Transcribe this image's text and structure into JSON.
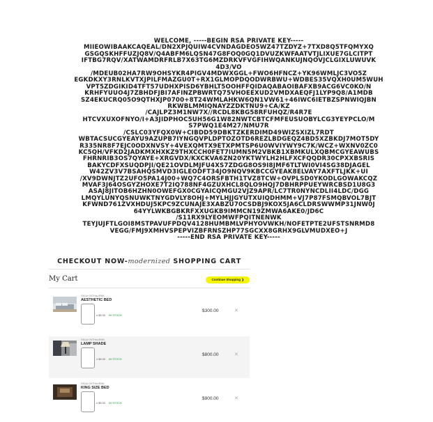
{
  "rsa_key": {
    "lines": [
      "WELCOME, -----BEGIN RSA PRIVATE KEY-----",
      "MIIEOWIBAAKCAQEAL/DN2XPJQUIW4CVNDAGDEO5WZ47TZDYZ+7TXD8Q5TFQMYXQ",
      "GSGQSKHFFUZJQ8V/Q4ABFM6LQSN47G8FOQ0GQ1DVUZKWFAATVTJLIXUE7GLCITPT",
      "IFTBG7RQV/XATWAMDRFRLB7X63TG6MZDRKVFVGFIHWQANKUJNQOVJCLGIXLUWUVK",
      "4D3/VO",
      "/MDEUB02HA7RW9OHSYKR4PIGV4MDWXGGL+FWO6HFNCZ+YK96WMLJC3VO5Z",
      "EGKDKXY3RNLKVTXJPILFMAZGU0T+RX1GLMOPDQODWRBWU+WDBES35VQXH0UM5WUH",
      "VPT5ZDGIKID4TFT57UDHXPISD6YBHLT5OOHFFQIDAQABAOIBAFXB9ACG6VC0KO/N",
      "KRHFYUUO4J7ZBHDFJBI7AFINZPBWRTQ75VHOEEXUD2VMDXAEQFJ1LYP9Q8/A1MDB",
      "SZ4EKUCRQ05O9QTHXJP0700+8T24WMLAHKW6QN1VW61+46IWC6IETBZSPNWIQJBN",
      "RKWBLMMIQNAYZZDKTNU9+CA/KZ",
      "/CAJLPZ3M1NW7X//RCDL8KBG58RFUHQZ/R4R7E",
      "HTCVXUXOFNYO/I+A3JIDPHOC5UH56G1W82NWTCBTCFMFEUSUOBYLCG3YEYPCLO/M",
      "S7PWQ1E4M27/NMU7R",
      "/CSLC03YFQX0W+CIBDD59DBKTZKERDIMD49WIZSXIZL7RDT",
      "WBTACSUCGYEAYU9AZUPB7IYNGQVPLDPTOZOTD6REZLBDGEQZ4BD5XZBKDJ7MOT5DY",
      "R335NR8F7EJC0ODXNVSY+4VEXQMTX9ETXPMTSP6U0WVIYWY9C7K/WCZ+WXNV0ZC0",
      "KC5QH/VFKD2JADKMXHXKZ9THXCCH0FET7IUMN5M2VBKB1XBMKULXQBMCGYEAWUBS",
      "FHRNRIB3OS7QYAYE+XRGVDX/KXCKVA6ZN20YKTWYLH2HLFXCFQQDR30CPXXBSRIS",
      "BAKYCDFXSUQDPJI/QE21OVDLMJFU4XS7ZDGG8OS9I8JMF6TLTWI0VI4SG38DJAGEL",
      "W42ZV3V7BSAHQSMVD3IGLEODFT34JO9NQV9KBCCGYEAK8ELVAY7AXFTLJKK+UI",
      "/XV9DWNJTZ2UFO5PA14J00+WQ7C4ORSFBTH1TVZ8TCW+OVPLSD0YKODLGOWAKCQZ",
      "MVAF3J64OSGYZHOXE7T2IQ788NF4GZUXHCL8QLO9HQJ7DBHRPPUEYWRCBSD1U8G3",
      "ASAJ8JITOB6HZHN0OWEFGX0CGYAICQMGU2VJZ9APR/LC7TR0NYNCDLII4LDC/DGG",
      "LMQYLUNYQSNUWKTNYGDVLY8OHJ+MYLHJJGYUTXUIQDHMM+VJ7P87FSMQBVOL7BJT",
      "KFWND761ZVXHDUJ5KPC9ZCUNAJE3XABZU70CSDBJ9KOX5JA6CLDRSWWMP31JNW0J",
      "64YYLWKBGBKRFXXUGKB9IMMCN19ZMWA6AKE0/JD6C",
      "/S11RX9LYEOMWFPQITNENWK",
      "TEYJUJFTLGOI8MSTPAVUFPDQV4128HUMBMLVPHYOVWKH/NOFETPTE2UFSTSNRMD8",
      "VEGG/FMJ9XMHVSPEPVIZBFRNSZHP77SGCXX8GRHX9GLVMUDXEO+J",
      "-----END RSA PRIVATE KEY-----"
    ]
  },
  "checkout": {
    "title_pre": "CHECKOUT NOW",
    "title_sep": "-",
    "title_italic": "modernized",
    "title_post": "SHOPPING CART"
  },
  "cart": {
    "title": "My Cart",
    "continue_label": "Continue Shopping ❯",
    "items": [
      {
        "sku": "SKU# 097HaoRNK",
        "name": "AESTHETIC BED",
        "unit_price": "x $5.00",
        "stock": "IN STOCK",
        "price": "$300.00",
        "remove_icon": "✕"
      },
      {
        "sku": "SKU# 097HaoRNK",
        "name": "LAMP SHADE",
        "unit_price": "x $5.00",
        "stock": "IN STOCK",
        "price": "$800.00",
        "remove_icon": "✕"
      },
      {
        "sku": "SKU# 097HaoRNK",
        "name": "KING SIZE BED",
        "unit_price": "x $5.00",
        "stock": "IN STOCK",
        "price": "$900.00",
        "remove_icon": "✕"
      }
    ]
  },
  "colors": {
    "accent_yellow": "#f5f500",
    "stock_green": "#1a9a3a",
    "row_alt": "#f4f4f4"
  }
}
